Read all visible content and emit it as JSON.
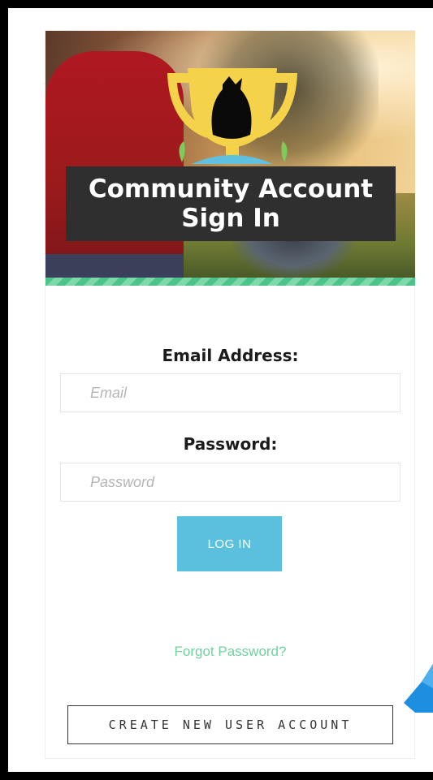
{
  "hero": {
    "title_line1": "Community Account",
    "title_line2": "Sign In",
    "trophy_icon": "trophy-icon",
    "bag_icon": "garbage-bag-icon"
  },
  "form": {
    "email_label": "Email Address:",
    "email_placeholder": "Email",
    "email_value": "",
    "password_label": "Password:",
    "password_placeholder": "Password",
    "password_value": "",
    "login_label": "LOG IN",
    "forgot_label": "Forgot Password?",
    "create_account_label": "CREATE NEW USER ACCOUNT"
  },
  "colors": {
    "login_button": "#5bc0de",
    "forgot_link": "#6fd19f",
    "stripe_green": "#4cc38a",
    "title_box": "#2f2f2f",
    "trophy_gold": "#f4d34a",
    "pointer_blue": "#1e8fe0"
  }
}
